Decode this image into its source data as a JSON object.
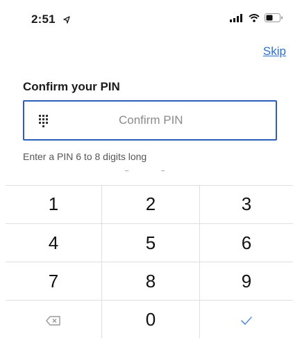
{
  "status": {
    "time": "2:51",
    "icons": [
      "location-arrow-icon",
      "signal-icon",
      "wifi-icon",
      "battery-icon"
    ]
  },
  "header": {
    "skip_label": "Skip"
  },
  "pin": {
    "title": "Confirm your PIN",
    "placeholder": "Confirm PIN",
    "value": "",
    "helper": "Enter a PIN 6 to 8 digits long"
  },
  "keypad": {
    "keys": [
      "1",
      "2",
      "3",
      "4",
      "5",
      "6",
      "7",
      "8",
      "9",
      "0"
    ],
    "backspace_icon": "backspace-icon",
    "confirm_icon": "check-icon"
  },
  "colors": {
    "accent": "#2a5eb8",
    "link": "#2a6fd1",
    "divider": "#dedede",
    "muted": "#8a8a8a"
  }
}
